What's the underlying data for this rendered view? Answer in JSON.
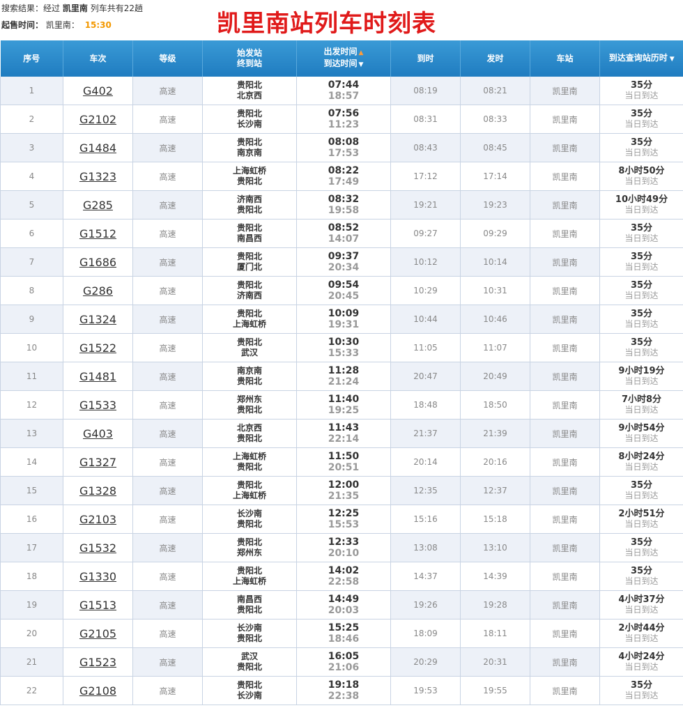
{
  "header": {
    "result_prefix": "搜索结果：经过",
    "result_station": "凯里南",
    "result_suffix": "列车共有22趟",
    "sale_label": "起售时间：",
    "sale_station": "凯里南：",
    "sale_time": "15:30",
    "page_title": "凯里南站列车时刻表"
  },
  "columns": {
    "index": "序号",
    "train": "车次",
    "grade": "等级",
    "start_station": "始发站",
    "end_station": "终到站",
    "depart_time": "出发时间",
    "arrive_time": "到达时间",
    "arrive": "到时",
    "leave": "发时",
    "station": "车站",
    "duration": "到达查询站历时"
  },
  "rows": [
    {
      "no": "1",
      "train": "G402",
      "grade": "高速",
      "from": "贵阳北",
      "to": "北京西",
      "dep": "07:44",
      "arr": "18:57",
      "arrive": "08:19",
      "leave": "08:21",
      "station": "凯里南",
      "dur": "35分",
      "day": "当日到达"
    },
    {
      "no": "2",
      "train": "G2102",
      "grade": "高速",
      "from": "贵阳北",
      "to": "长沙南",
      "dep": "07:56",
      "arr": "11:23",
      "arrive": "08:31",
      "leave": "08:33",
      "station": "凯里南",
      "dur": "35分",
      "day": "当日到达"
    },
    {
      "no": "3",
      "train": "G1484",
      "grade": "高速",
      "from": "贵阳北",
      "to": "南京南",
      "dep": "08:08",
      "arr": "17:53",
      "arrive": "08:43",
      "leave": "08:45",
      "station": "凯里南",
      "dur": "35分",
      "day": "当日到达"
    },
    {
      "no": "4",
      "train": "G1323",
      "grade": "高速",
      "from": "上海虹桥",
      "to": "贵阳北",
      "dep": "08:22",
      "arr": "17:49",
      "arrive": "17:12",
      "leave": "17:14",
      "station": "凯里南",
      "dur": "8小时50分",
      "day": "当日到达"
    },
    {
      "no": "5",
      "train": "G285",
      "grade": "高速",
      "from": "济南西",
      "to": "贵阳北",
      "dep": "08:32",
      "arr": "19:58",
      "arrive": "19:21",
      "leave": "19:23",
      "station": "凯里南",
      "dur": "10小时49分",
      "day": "当日到达"
    },
    {
      "no": "6",
      "train": "G1512",
      "grade": "高速",
      "from": "贵阳北",
      "to": "南昌西",
      "dep": "08:52",
      "arr": "14:07",
      "arrive": "09:27",
      "leave": "09:29",
      "station": "凯里南",
      "dur": "35分",
      "day": "当日到达"
    },
    {
      "no": "7",
      "train": "G1686",
      "grade": "高速",
      "from": "贵阳北",
      "to": "厦门北",
      "dep": "09:37",
      "arr": "20:34",
      "arrive": "10:12",
      "leave": "10:14",
      "station": "凯里南",
      "dur": "35分",
      "day": "当日到达"
    },
    {
      "no": "8",
      "train": "G286",
      "grade": "高速",
      "from": "贵阳北",
      "to": "济南西",
      "dep": "09:54",
      "arr": "20:45",
      "arrive": "10:29",
      "leave": "10:31",
      "station": "凯里南",
      "dur": "35分",
      "day": "当日到达"
    },
    {
      "no": "9",
      "train": "G1324",
      "grade": "高速",
      "from": "贵阳北",
      "to": "上海虹桥",
      "dep": "10:09",
      "arr": "19:31",
      "arrive": "10:44",
      "leave": "10:46",
      "station": "凯里南",
      "dur": "35分",
      "day": "当日到达"
    },
    {
      "no": "10",
      "train": "G1522",
      "grade": "高速",
      "from": "贵阳北",
      "to": "武汉",
      "dep": "10:30",
      "arr": "15:33",
      "arrive": "11:05",
      "leave": "11:07",
      "station": "凯里南",
      "dur": "35分",
      "day": "当日到达"
    },
    {
      "no": "11",
      "train": "G1481",
      "grade": "高速",
      "from": "南京南",
      "to": "贵阳北",
      "dep": "11:28",
      "arr": "21:24",
      "arrive": "20:47",
      "leave": "20:49",
      "station": "凯里南",
      "dur": "9小时19分",
      "day": "当日到达"
    },
    {
      "no": "12",
      "train": "G1533",
      "grade": "高速",
      "from": "郑州东",
      "to": "贵阳北",
      "dep": "11:40",
      "arr": "19:25",
      "arrive": "18:48",
      "leave": "18:50",
      "station": "凯里南",
      "dur": "7小时8分",
      "day": "当日到达"
    },
    {
      "no": "13",
      "train": "G403",
      "grade": "高速",
      "from": "北京西",
      "to": "贵阳北",
      "dep": "11:43",
      "arr": "22:14",
      "arrive": "21:37",
      "leave": "21:39",
      "station": "凯里南",
      "dur": "9小时54分",
      "day": "当日到达"
    },
    {
      "no": "14",
      "train": "G1327",
      "grade": "高速",
      "from": "上海虹桥",
      "to": "贵阳北",
      "dep": "11:50",
      "arr": "20:51",
      "arrive": "20:14",
      "leave": "20:16",
      "station": "凯里南",
      "dur": "8小时24分",
      "day": "当日到达"
    },
    {
      "no": "15",
      "train": "G1328",
      "grade": "高速",
      "from": "贵阳北",
      "to": "上海虹桥",
      "dep": "12:00",
      "arr": "21:35",
      "arrive": "12:35",
      "leave": "12:37",
      "station": "凯里南",
      "dur": "35分",
      "day": "当日到达"
    },
    {
      "no": "16",
      "train": "G2103",
      "grade": "高速",
      "from": "长沙南",
      "to": "贵阳北",
      "dep": "12:25",
      "arr": "15:53",
      "arrive": "15:16",
      "leave": "15:18",
      "station": "凯里南",
      "dur": "2小时51分",
      "day": "当日到达"
    },
    {
      "no": "17",
      "train": "G1532",
      "grade": "高速",
      "from": "贵阳北",
      "to": "郑州东",
      "dep": "12:33",
      "arr": "20:10",
      "arrive": "13:08",
      "leave": "13:10",
      "station": "凯里南",
      "dur": "35分",
      "day": "当日到达"
    },
    {
      "no": "18",
      "train": "G1330",
      "grade": "高速",
      "from": "贵阳北",
      "to": "上海虹桥",
      "dep": "14:02",
      "arr": "22:58",
      "arrive": "14:37",
      "leave": "14:39",
      "station": "凯里南",
      "dur": "35分",
      "day": "当日到达"
    },
    {
      "no": "19",
      "train": "G1513",
      "grade": "高速",
      "from": "南昌西",
      "to": "贵阳北",
      "dep": "14:49",
      "arr": "20:03",
      "arrive": "19:26",
      "leave": "19:28",
      "station": "凯里南",
      "dur": "4小时37分",
      "day": "当日到达"
    },
    {
      "no": "20",
      "train": "G2105",
      "grade": "高速",
      "from": "长沙南",
      "to": "贵阳北",
      "dep": "15:25",
      "arr": "18:46",
      "arrive": "18:09",
      "leave": "18:11",
      "station": "凯里南",
      "dur": "2小时44分",
      "day": "当日到达"
    },
    {
      "no": "21",
      "train": "G1523",
      "grade": "高速",
      "from": "武汉",
      "to": "贵阳北",
      "dep": "16:05",
      "arr": "21:06",
      "arrive": "20:29",
      "leave": "20:31",
      "station": "凯里南",
      "dur": "4小时24分",
      "day": "当日到达"
    },
    {
      "no": "22",
      "train": "G2108",
      "grade": "高速",
      "from": "贵阳北",
      "to": "长沙南",
      "dep": "19:18",
      "arr": "22:38",
      "arrive": "19:53",
      "leave": "19:55",
      "station": "凯里南",
      "dur": "35分",
      "day": "当日到达"
    }
  ],
  "colors": {
    "header_bg": "#1f7cc0",
    "title_red": "#e01a1a",
    "sale_time_orange": "#f39800",
    "row_alt": "#edf1f8"
  },
  "icons": {
    "sort_asc": "sort-up-icon",
    "sort_desc": "sort-down-icon",
    "dropdown": "dropdown-icon"
  }
}
